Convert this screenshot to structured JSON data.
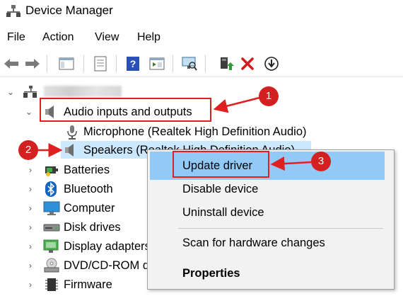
{
  "window": {
    "title": "Device Manager",
    "icon": "device-manager-icon"
  },
  "menubar": {
    "items": [
      "File",
      "Action",
      "View",
      "Help"
    ]
  },
  "toolbar": {
    "buttons": [
      "back-arrow-icon",
      "forward-arrow-icon",
      "console-tree-icon",
      "properties-icon",
      "help-icon",
      "show-hide-icon",
      "scan-monitor-icon",
      "update-driver-icon",
      "uninstall-x-icon",
      "download-arrow-icon"
    ]
  },
  "tree": {
    "root": {
      "label": ""
    },
    "audio_group": {
      "label": "Audio inputs and outputs"
    },
    "microphone": {
      "label": "Microphone (Realtek High Definition Audio)"
    },
    "speakers": {
      "label": "Speakers (Realtek High Definition Audio)"
    },
    "categories": [
      "Batteries",
      "Bluetooth",
      "Computer",
      "Disk drives",
      "Display adapters",
      "DVD/CD-ROM drives",
      "Firmware"
    ]
  },
  "context_menu": {
    "update_driver": "Update driver",
    "disable_device": "Disable device",
    "uninstall_device": "Uninstall device",
    "scan_changes": "Scan for hardware changes",
    "properties": "Properties"
  },
  "annotations": {
    "step1": "1",
    "step2": "2",
    "step3": "3",
    "color": "#e02020"
  }
}
